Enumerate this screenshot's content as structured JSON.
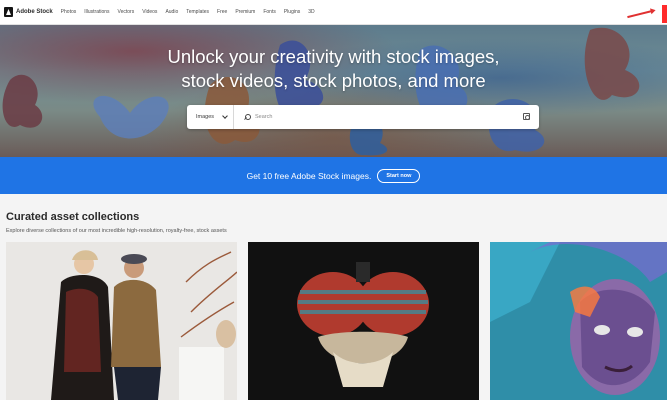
{
  "nav": {
    "logo_text": "Adobe Stock",
    "links": [
      "Photos",
      "Illustrations",
      "Vectors",
      "Videos",
      "Audio",
      "Templates",
      "Free",
      "Premium",
      "Fonts",
      "Plugins",
      "3D"
    ]
  },
  "hero": {
    "title_line1": "Unlock your creativity with stock images,",
    "title_line2": "stock videos, stock photos, and more",
    "search": {
      "category": "Images",
      "placeholder": "Search"
    }
  },
  "promo": {
    "text": "Get 10 free Adobe Stock images.",
    "button": "Start now"
  },
  "curated": {
    "title": "Curated asset collections",
    "subtitle": "Explore diverse collections of our most incredible high-resolution, royalty-free, stock assets"
  },
  "colors": {
    "accent": "#1f74e5",
    "annotation_red": "#e03131"
  },
  "icons": [
    "adobe-logo-icon",
    "chevron-down-icon",
    "search-icon",
    "visual-search-icon",
    "arrow-annotation-icon"
  ]
}
